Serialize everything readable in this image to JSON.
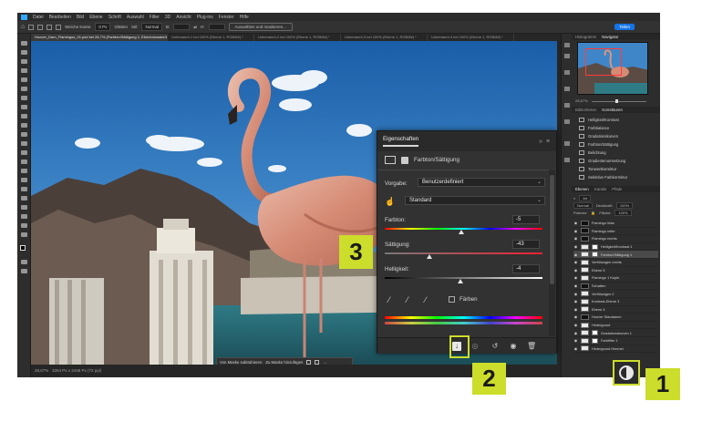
{
  "menubar": {
    "items": [
      "Datei",
      "Bearbeiten",
      "Bild",
      "Ebene",
      "Schrift",
      "Auswahl",
      "Filter",
      "3D",
      "Ansicht",
      "Plug-ins",
      "Fenster",
      "Hilfe"
    ]
  },
  "optionsbar": {
    "weiche_kante_label": "Weiche Kante:",
    "weiche_kante_value": "0 Px",
    "glaetten_label": "Glätten",
    "stil_label": "Stil:",
    "stil_value": "Normal",
    "breite_label": "B:",
    "hoehe_label": "H:",
    "select_mask_button": "Auswählen und maskieren...",
    "share_button": "Teilen"
  },
  "tabs": [
    {
      "label": "Hoover_Dam_Flamingos_01.psd bei 28,7% (Farbton/Sättigung 1, Ebenenmaske/8) *",
      "active": true
    },
    {
      "label": "Unbenannt-1 bei 100% (Ebene 1, RGB/8#) *",
      "active": false
    },
    {
      "label": "Unbenannt-2 bei 100% (Ebene 1, RGB/8#) *",
      "active": false
    },
    {
      "label": "Unbenannt-3 bei 100% (Ebene 1, RGB/8#) *",
      "active": false
    },
    {
      "label": "Unbenannt-4 bei 100% (Ebene 1, RGB/8#) *",
      "active": false
    }
  ],
  "statusbar": {
    "zoom": "28,67%",
    "doc_size": "3264 Px x 2448 Px (72 ppi)"
  },
  "contextbar": {
    "invert_mask": "Von Maske subtrahieren",
    "add_mask": "Zu Maske hinzufügen"
  },
  "navigator": {
    "tab_1": "Histogramm",
    "tab_2": "Navigator",
    "zoom_label": "28,67%"
  },
  "library": {
    "tab_1": "Bibliotheken",
    "tab_2": "Korrekturen",
    "items": [
      "Helligkeit/Kontrast",
      "Farbbalance",
      "Gradationskurven",
      "Farbton/Sättigung",
      "Belichtung",
      "Gradientenumsetzung",
      "Tonwertkorrektur",
      "Selektive Farbkorrektur",
      "Farbfilter"
    ]
  },
  "layers_panel": {
    "tabs": [
      "Ebenen",
      "Kanäle",
      "Pfade"
    ],
    "search_label": "Art",
    "blend_mode": "Normal",
    "opacity_label": "Deckkraft:",
    "opacity_value": "100%",
    "lock_label": "Fixieren:",
    "fill_label": "Fläche:",
    "fill_value": "100%",
    "layers": [
      {
        "name": "Flamingo links",
        "type": "group",
        "selected": false
      },
      {
        "name": "Flamingo mitte",
        "type": "group",
        "selected": false
      },
      {
        "name": "Flamingo rechts",
        "type": "group",
        "selected": false
      },
      {
        "name": "Helligkeit/Kontrast 1",
        "type": "adjust",
        "selected": false
      },
      {
        "name": "Farbton/Sättigung 1",
        "type": "adjust",
        "selected": true
      },
      {
        "name": "Verflüssigen rechts",
        "type": "pixel",
        "selected": false
      },
      {
        "name": "Ebene 5",
        "type": "pixel",
        "selected": false
      },
      {
        "name": "Flamingo 1 Kopie",
        "type": "pixel",
        "selected": false
      },
      {
        "name": "Schatten",
        "type": "group",
        "selected": false
      },
      {
        "name": "Verflüssigen 2",
        "type": "pixel",
        "selected": false
      },
      {
        "name": "Kontrast-Ebene 3",
        "type": "pixel",
        "selected": false
      },
      {
        "name": "Ebene 4",
        "type": "pixel",
        "selected": false
      },
      {
        "name": "Hoover Staudamm",
        "type": "group",
        "selected": false
      },
      {
        "name": "Hintergrund",
        "type": "pixel",
        "selected": false
      },
      {
        "name": "Gradationskurven 1",
        "type": "adjust",
        "selected": false
      },
      {
        "name": "Farbfilter 1",
        "type": "adjust",
        "selected": false
      },
      {
        "name": "Hintergrund Himmel",
        "type": "pixel",
        "selected": false
      }
    ]
  },
  "properties": {
    "title": "Eigenschaften",
    "subtitle": "Farbton/Sättigung",
    "preset_label": "Vorgabe:",
    "preset_value": "Benutzerdefiniert",
    "channel_value": "Standard",
    "hue_label": "Farbton:",
    "hue_value": "-5",
    "hue_level": -5,
    "sat_label": "Sättigung:",
    "sat_value": "-43",
    "sat_level": -43,
    "light_label": "Helligkeit:",
    "light_value": "-4",
    "light_level": -4,
    "colorize_label": "Färben"
  },
  "callouts": {
    "one": "1",
    "two": "2",
    "three": "3"
  },
  "colors": {
    "accent": "#ccdd2b",
    "share": "#1473e6"
  }
}
